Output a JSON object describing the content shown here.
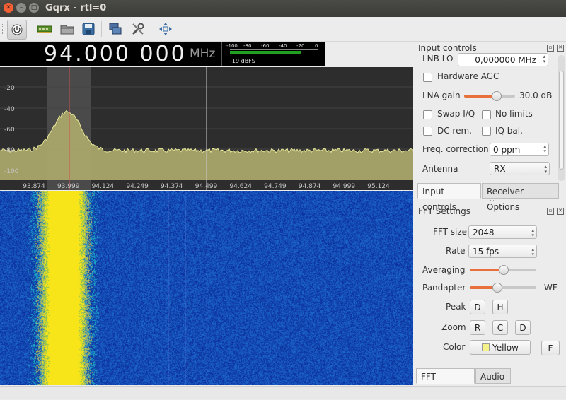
{
  "window": {
    "title": "Gqrx  - rtl=0"
  },
  "toolbar": {
    "items": [
      "power-icon",
      "device-icon",
      "open-folder-icon",
      "save-icon",
      "network-icon",
      "tools-icon",
      "fullscreen-icon"
    ]
  },
  "frequency": {
    "value": "94.000 000",
    "unit": "MHz"
  },
  "signal_meter": {
    "ticks": [
      "-100",
      "-80",
      "-60",
      "-40",
      "-20",
      "0"
    ],
    "level_fraction": 0.81,
    "label": "-19 dBFS",
    "color": "#1fa01f"
  },
  "plot": {
    "y_ticks": [
      "-20",
      "-40",
      "-60",
      "-80",
      "-100"
    ],
    "x_ticks": [
      "93.874",
      "93.999",
      "94.124",
      "94.249",
      "94.374",
      "94.499",
      "94.624",
      "94.749",
      "94.874",
      "94.999",
      "95.124"
    ],
    "trace_color": "#e8e89a",
    "fill_color": "#a9a56a",
    "center_line_color": "#d05050"
  },
  "waterfall": {
    "background": "#0f1f9c",
    "signal_color": "#f7e51a"
  },
  "input_controls": {
    "title": "Input controls",
    "lnb_lo_label": "LNB LO",
    "lnb_lo_value": "0,000000 MHz",
    "hardware_agc_label": "Hardware AGC",
    "hardware_agc_checked": false,
    "lna_gain_label": "LNA gain",
    "lna_gain_value": "30.0 dB",
    "lna_gain_fraction": 0.62,
    "swap_iq_label": "Swap I/Q",
    "no_limits_label": "No limits",
    "dc_rem_label": "DC rem.",
    "iq_bal_label": "IQ bal.",
    "freq_correction_label": "Freq. correction",
    "freq_correction_value": "0 ppm",
    "antenna_label": "Antenna",
    "antenna_value": "RX"
  },
  "upper_tabs": {
    "tab1": "Input controls",
    "tab2": "Receiver Options"
  },
  "fft_settings": {
    "title": "FFT Settings",
    "fft_size_label": "FFT size",
    "fft_size_value": "2048",
    "rate_label": "Rate",
    "rate_value": "15 fps",
    "averaging_label": "Averaging",
    "averaging_fraction": 0.5,
    "pandapter_label": "Pandapter",
    "pandapter_fraction": 0.4,
    "wf_label": "WF",
    "peak_label": "Peak",
    "peak_d": "D",
    "peak_h": "H",
    "zoom_label": "Zoom",
    "zoom_r": "R",
    "zoom_c": "C",
    "zoom_d": "D",
    "color_label": "Color",
    "color_value": "Yellow",
    "color_swatch": "#f5f28a",
    "f_button": "F"
  },
  "lower_tabs": {
    "tab1": "FFT Settings",
    "tab2": "Audio"
  }
}
